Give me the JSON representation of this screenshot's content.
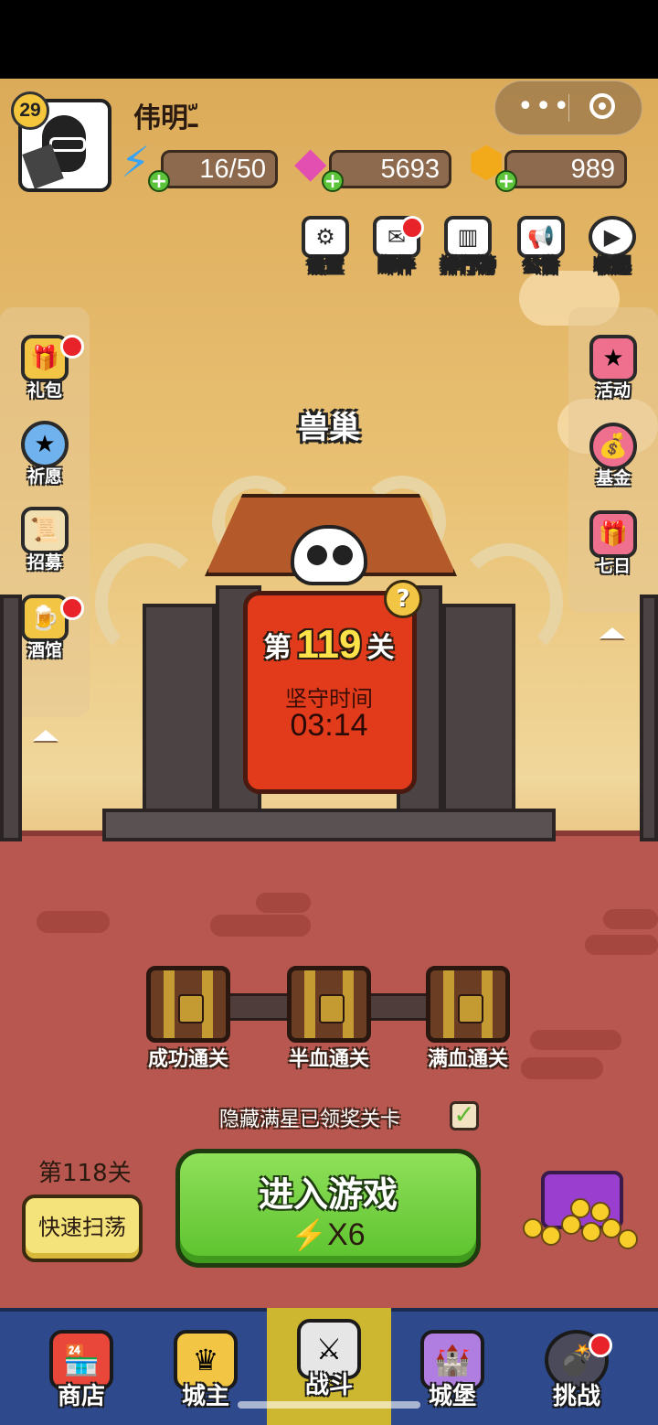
{
  "player": {
    "level": "29",
    "name": "伟明ـّ"
  },
  "resources": {
    "energy": "16/50",
    "gems": "5693",
    "coins": "989"
  },
  "capsule": {
    "more": "•••"
  },
  "top_icons": [
    {
      "label": "设置",
      "icon": "gear-icon"
    },
    {
      "label": "邮件",
      "icon": "mail-icon"
    },
    {
      "label": "排行榜",
      "icon": "leaderboard-icon"
    },
    {
      "label": "公告",
      "icon": "megaphone-icon"
    },
    {
      "label": "收起",
      "icon": "collapse-icon"
    }
  ],
  "left_menu": [
    {
      "label": "礼包",
      "icon": "gift-box-icon"
    },
    {
      "label": "祈愿",
      "icon": "wish-icon"
    },
    {
      "label": "招募",
      "icon": "recruit-scroll-icon"
    },
    {
      "label": "酒馆",
      "icon": "beer-mug-icon"
    }
  ],
  "right_menu": [
    {
      "label": "活动",
      "icon": "event-gift-icon"
    },
    {
      "label": "基金",
      "icon": "fund-bag-icon"
    },
    {
      "label": "七日",
      "icon": "seven-day-gift-icon"
    }
  ],
  "stage": {
    "name": "兽巢",
    "prefix": "第",
    "number": "119",
    "suffix": "关",
    "hold_label": "坚守时间",
    "hold_time": "03:14",
    "help": "?"
  },
  "chests": [
    {
      "label": "成功通关"
    },
    {
      "label": "半血通关"
    },
    {
      "label": "满血通关"
    }
  ],
  "hidden_toggle": {
    "label": "隐藏满星已领奖关卡",
    "checked": "✓"
  },
  "prev_stage": "第118关",
  "sweep_button": "快速扫荡",
  "enter_button": {
    "title": "进入游戏",
    "cost": "X6",
    "bolt": "⚡"
  },
  "bottom_nav": [
    {
      "label": "商店",
      "icon": "shop-icon"
    },
    {
      "label": "城主",
      "icon": "crown-icon"
    },
    {
      "label": "战斗",
      "icon": "crossed-swords-icon",
      "active": true
    },
    {
      "label": "城堡",
      "icon": "castle-icon"
    },
    {
      "label": "挑战",
      "icon": "bomb-monster-icon"
    }
  ],
  "colors": {
    "sky_top": "#dcab59",
    "ground": "#b8574f",
    "banner_red": "#e23b1c",
    "enter_green": "#5cc22d",
    "nav_blue": "#2f4a8c",
    "nav_active": "#cdb630",
    "badge_red": "#e8242a"
  }
}
